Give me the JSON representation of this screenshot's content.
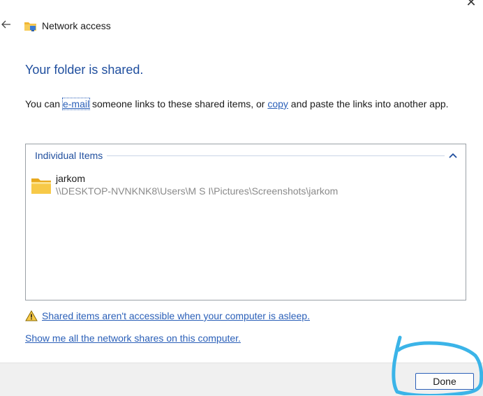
{
  "window": {
    "title": "Network access",
    "close_glyph": "✕",
    "back_glyph": "←"
  },
  "main": {
    "heading": "Your folder is shared.",
    "desc_prefix": "You can ",
    "email_link": "e-mail",
    "desc_middle": " someone links to these shared items, or ",
    "copy_link": "copy",
    "desc_suffix": " and paste the links into another app."
  },
  "items_group": {
    "label": "Individual Items",
    "chevron_icon": "chevron-up-icon",
    "items": [
      {
        "name": "jarkom",
        "path": "\\\\DESKTOP-NVNKNK8\\Users\\M S I\\Pictures\\Screenshots\\jarkom",
        "icon": "folder-icon"
      }
    ]
  },
  "warning": {
    "icon": "warning-icon",
    "link_text": "Shared items aren't accessible when your computer is asleep."
  },
  "shares_link": "Show me all the network shares on this computer.",
  "footer": {
    "done_label": "Done"
  },
  "colors": {
    "accent": "#1f4e9e",
    "link": "#2a5fb8",
    "annotation": "#3bb4e8"
  }
}
